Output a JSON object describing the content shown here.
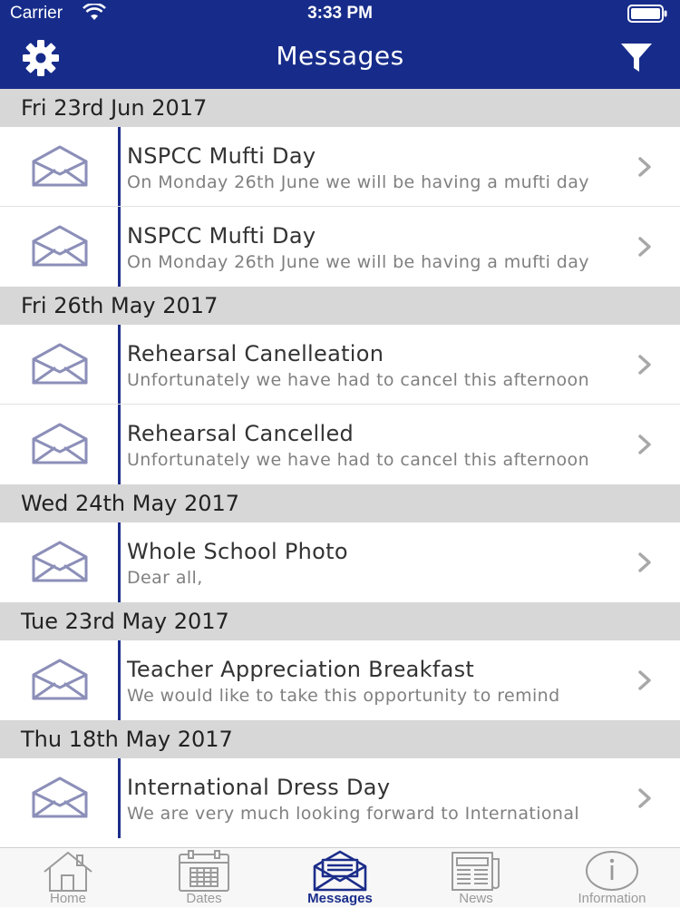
{
  "status_bar": {
    "carrier": "Carrier",
    "time": "3:33 PM"
  },
  "header": {
    "title": "Messages"
  },
  "sections": [
    {
      "date": "Fri 23rd Jun 2017",
      "items": [
        {
          "title": "NSPCC Mufti Day",
          "preview": "On Monday 26th June we will be having a mufti day"
        },
        {
          "title": "NSPCC Mufti Day",
          "preview": "On Monday 26th June we will be having a mufti day"
        }
      ]
    },
    {
      "date": "Fri 26th May 2017",
      "items": [
        {
          "title": "Rehearsal Canelleation",
          "preview": "Unfortunately we have had to cancel this afternoon"
        },
        {
          "title": "Rehearsal Cancelled",
          "preview": "Unfortunately we have had to cancel this afternoon"
        }
      ]
    },
    {
      "date": "Wed 24th May 2017",
      "items": [
        {
          "title": "Whole School Photo",
          "preview": "Dear all,"
        }
      ]
    },
    {
      "date": "Tue 23rd May 2017",
      "items": [
        {
          "title": "Teacher Appreciation Breakfast",
          "preview": "We would like to take this opportunity to remind"
        }
      ]
    },
    {
      "date": "Thu 18th May 2017",
      "items": [
        {
          "title": "International Dress Day",
          "preview": "We are very much looking forward to International"
        }
      ]
    }
  ],
  "tabs": [
    {
      "label": "Home",
      "icon": "home-icon",
      "active": false
    },
    {
      "label": "Dates",
      "icon": "calendar-icon",
      "active": false
    },
    {
      "label": "Messages",
      "icon": "envelope-icon",
      "active": true
    },
    {
      "label": "News",
      "icon": "newspaper-icon",
      "active": false
    },
    {
      "label": "Information",
      "icon": "info-icon",
      "active": false
    }
  ],
  "colors": {
    "header_bg": "#172c8a",
    "accent": "#1b2d8a",
    "section_bg": "#d7d7d7",
    "envelope": "#8c8fb8"
  }
}
